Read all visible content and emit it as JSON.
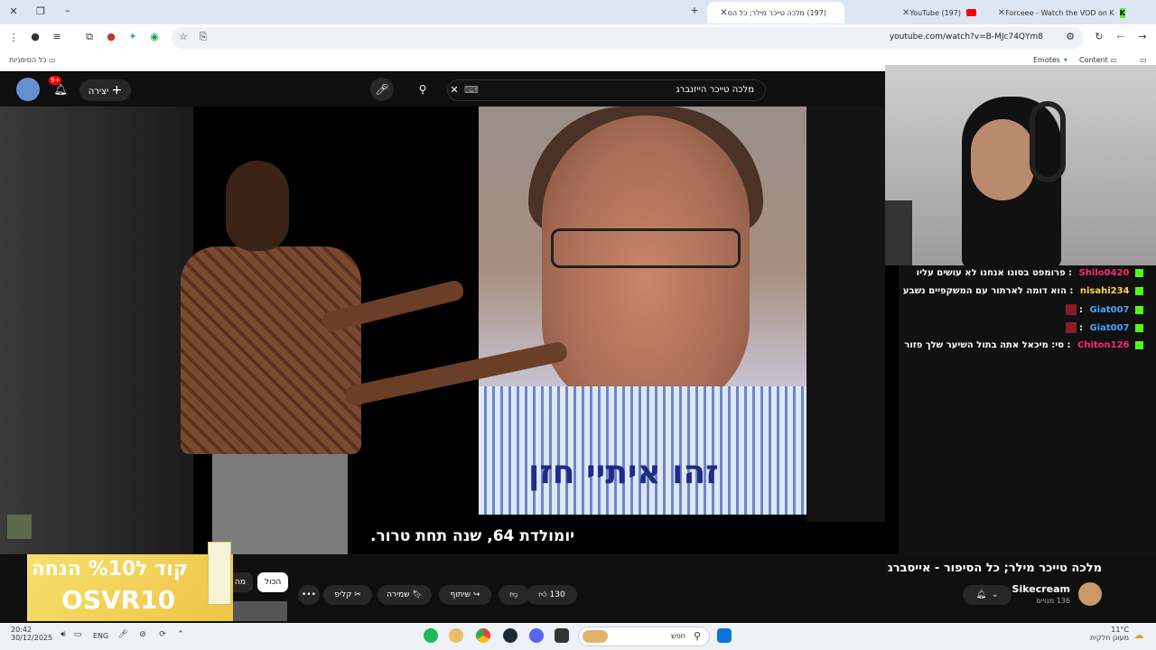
{
  "browser": {
    "tabs": [
      {
        "label": "(197) מלכה טייכר מילר; כל הס",
        "active": true
      },
      {
        "label": "(197) YouTube",
        "active": false
      },
      {
        "label": "Forceee - Watch the VOD on K",
        "active": false
      }
    ],
    "url": "youtube.com/watch?v=B-MJc74QYm8",
    "bookmarks_all": "כל הסימניות",
    "bookmark_emotes": "Emotes",
    "bookmark_content": "Content"
  },
  "youtube": {
    "search_value": "מלכה טייכר הייזנברג",
    "create_label": "יצירה",
    "notifications_badge": "9+",
    "video_subtitle": "יומולדת 64, שנה תחת טרור.",
    "image_caption": "זהו איתיי חזן",
    "video_title": "מלכה טייכר מילר; כל הסיפור - אייסברג",
    "channel_name": "Sikecream",
    "subscribers": "136 מנויים",
    "likes": "130",
    "share_label": "שיתוף",
    "save_label": "שמירה",
    "clip_label": "קליפ",
    "more_label": "•••",
    "chip_all": "הכול",
    "chip_partial": "מה"
  },
  "ad": {
    "line1": "קוד ל%10 הנחה",
    "line2": "OSVR10"
  },
  "chat": [
    {
      "user": "Shilo0420",
      "message": "פרומפט בסונו אנחנו לא עושים עליו",
      "color": "#ff2a6d"
    },
    {
      "user": "nisahi234",
      "message": "הוא דומה לארתור עם המשקפיים נשבע",
      "color": "#ffd24d"
    },
    {
      "user": "Giat007",
      "message": "",
      "color": "#4aa3ff"
    },
    {
      "user": "Giat007",
      "message": "",
      "color": "#4aa3ff"
    },
    {
      "user": "Chiton126",
      "message": "סי: מיכאל אתה בתול השיער שלך פזור",
      "color": "#ff2a6d"
    }
  ],
  "taskbar": {
    "time": "20:42",
    "date": "30/12/2025",
    "lang": "ENG",
    "search_placeholder": "חפש",
    "weather_temp": "11°C",
    "weather_desc": "מעונן חלקית"
  },
  "colors": {
    "youtube_red": "#ff0000",
    "kick_green": "#53fc18"
  }
}
